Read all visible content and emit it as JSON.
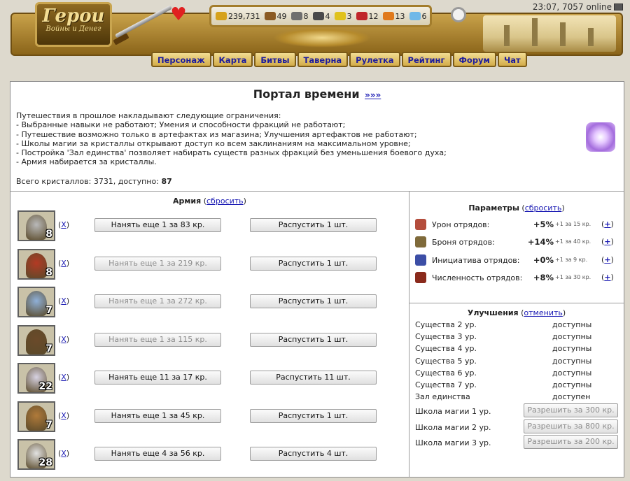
{
  "header": {
    "logo_title": "Герои",
    "logo_subtitle": "Войны и Денег",
    "resources": [
      {
        "icon": "gold-icon",
        "color": "#d6a21c",
        "value": "239,731"
      },
      {
        "icon": "wood-icon",
        "color": "#8b5a22",
        "value": "49"
      },
      {
        "icon": "ore-icon",
        "color": "#6f6f6f",
        "value": "8"
      },
      {
        "icon": "mercury-icon",
        "color": "#4a4a4a",
        "value": "4"
      },
      {
        "icon": "sulfur-icon",
        "color": "#e0c21c",
        "value": "3"
      },
      {
        "icon": "crystals-icon",
        "color": "#c0262a",
        "value": "12"
      },
      {
        "icon": "gems-icon",
        "color": "#e07a1c",
        "value": "13"
      },
      {
        "icon": "diamond-icon",
        "color": "#6fb8e8",
        "value": "6"
      }
    ],
    "clock": "23:07, 7057 online",
    "nav": [
      "Персонаж",
      "Карта",
      "Битвы",
      "Таверна",
      "Рулетка",
      "Рейтинг",
      "Форум",
      "Чат"
    ]
  },
  "main": {
    "title": "Портал времени",
    "title_link": "»»»",
    "info_lines": [
      "Путешествия в прошлое накладывают следующие ограничения:",
      "- Выбранные навыки не работают; Умения и способности фракций не работают;",
      "- Путешествие возможно только в артефактах из магазина; Улучшения артефактов не работают;",
      "- Школы магии за кристаллы открывают доступ ко всем заклинаниям на максимальном уровне;",
      "- Постройка 'Зал единства' позволяет набирать существ разных фракций без уменьшения боевого духа;",
      "- Армия набирается за кристаллы."
    ],
    "totals_prefix": "Всего кристаллов: 3731, доступно:",
    "totals_available": "87"
  },
  "army": {
    "title": "Армия",
    "reset": "сбросить",
    "x_label": "X",
    "units": [
      {
        "count": "8",
        "color": "#b9b9b9",
        "hire": "Нанять еще 1 за 83 кр.",
        "hire_disabled": false,
        "dismiss": "Распустить 1 шт."
      },
      {
        "count": "8",
        "color": "#b33a24",
        "hire": "Нанять еще 1 за 219 кр.",
        "hire_disabled": true,
        "dismiss": "Распустить 1 шт."
      },
      {
        "count": "7",
        "color": "#8fb0d8",
        "hire": "Нанять еще 1 за 272 кр.",
        "hire_disabled": true,
        "dismiss": "Распустить 1 шт."
      },
      {
        "count": "7",
        "color": "#6b4a2a",
        "hire": "Нанять еще 1 за 115 кр.",
        "hire_disabled": true,
        "dismiss": "Распустить 1 шт."
      },
      {
        "count": "22",
        "color": "#d7d2e2",
        "hire": "Нанять еще 11 за 17 кр.",
        "hire_disabled": false,
        "dismiss": "Распустить 11 шт."
      },
      {
        "count": "7",
        "color": "#b07a3a",
        "hire": "Нанять еще 1 за 45 кр.",
        "hire_disabled": false,
        "dismiss": "Распустить 1 шт."
      },
      {
        "count": "28",
        "color": "#e2e2e2",
        "hire": "Нанять еще 4 за 56 кр.",
        "hire_disabled": false,
        "dismiss": "Распустить 4 шт."
      }
    ]
  },
  "params": {
    "title": "Параметры",
    "reset": "сбросить",
    "rows": [
      {
        "icon": "damage-icon",
        "color": "#b44d3c",
        "label": "Урон отрядов:",
        "value": "+5%",
        "note": "+1 за 15 кр.",
        "plus": "+"
      },
      {
        "icon": "armor-icon",
        "color": "#7f6a3a",
        "label": "Броня отрядов:",
        "value": "+14%",
        "note": "+1 за 40 кр.",
        "plus": "+"
      },
      {
        "icon": "initiative-icon",
        "color": "#3c4ea6",
        "label": "Инициатива отрядов:",
        "value": "+0%",
        "note": "+1 за 9 кр.",
        "plus": "+"
      },
      {
        "icon": "numbers-icon",
        "color": "#8a2a1c",
        "label": "Численность отрядов:",
        "value": "+8%",
        "note": "+1 за 30 кр.",
        "plus": "+"
      }
    ]
  },
  "upgrades": {
    "title": "Улучшения",
    "cancel": "отменить",
    "rows": [
      {
        "label": "Существа 2 ур.",
        "status": "доступны"
      },
      {
        "label": "Существа 3 ур.",
        "status": "доступны"
      },
      {
        "label": "Существа 4 ур.",
        "status": "доступны"
      },
      {
        "label": "Существа 5 ур.",
        "status": "доступны"
      },
      {
        "label": "Существа 6 ур.",
        "status": "доступны"
      },
      {
        "label": "Существа 7 ур.",
        "status": "доступны"
      },
      {
        "label": "Зал единства",
        "status": "доступен"
      }
    ],
    "schools": [
      {
        "label": "Школа магии 1 ур.",
        "button": "Разрешить за 300 кр."
      },
      {
        "label": "Школа магии 2 ур.",
        "button": "Разрешить за 800 кр."
      },
      {
        "label": "Школа магии 3 ур.",
        "button": "Разрешить за 200 кр."
      }
    ]
  }
}
